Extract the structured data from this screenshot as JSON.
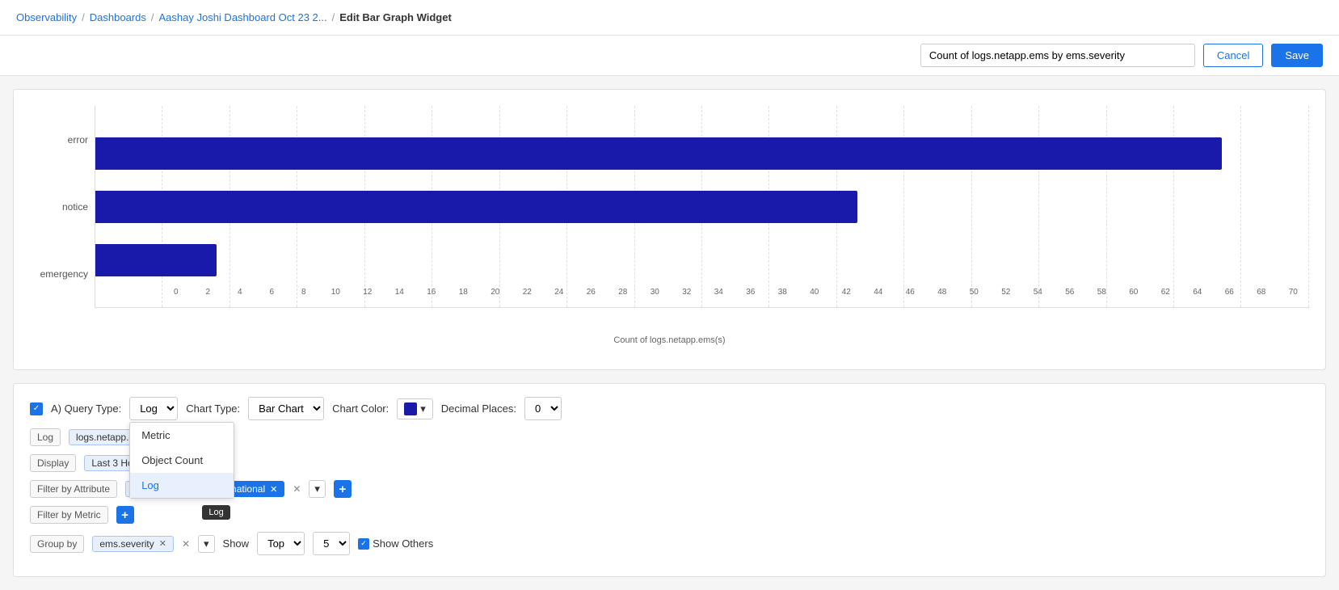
{
  "breadcrumb": {
    "items": [
      {
        "label": "Observability"
      },
      {
        "label": "Dashboards"
      },
      {
        "label": "Aashay Joshi Dashboard Oct 23 2..."
      }
    ],
    "current": "Edit Bar Graph Widget"
  },
  "header": {
    "widget_name": "Count of logs.netapp.ems by ems.severity",
    "cancel_label": "Cancel",
    "save_label": "Save"
  },
  "chart": {
    "bars": [
      {
        "label": "error",
        "value": 65,
        "max": 70
      },
      {
        "label": "notice",
        "value": 44,
        "max": 70
      },
      {
        "label": "emergency",
        "value": 7,
        "max": 70
      }
    ],
    "x_axis_labels": [
      "0",
      "2",
      "4",
      "6",
      "8",
      "10",
      "12",
      "14",
      "16",
      "18",
      "20",
      "22",
      "24",
      "26",
      "28",
      "30",
      "32",
      "34",
      "36",
      "38",
      "40",
      "42",
      "44",
      "46",
      "48",
      "50",
      "52",
      "54",
      "56",
      "58",
      "60",
      "62",
      "64",
      "66",
      "68",
      "70"
    ],
    "x_axis_title": "Count of logs.netapp.ems(s)"
  },
  "config": {
    "query_type_label": "A) Query Type:",
    "query_type_value": "Log",
    "query_type_options": [
      "Metric",
      "Object Count",
      "Log"
    ],
    "chart_type_label": "Chart Type:",
    "chart_type_value": "Bar Chart",
    "chart_color_label": "Chart Color:",
    "decimal_label": "Decimal Places:",
    "decimal_value": "0",
    "log_tag": "Log",
    "datasource_tag": "logs.netapp.ems",
    "display_label": "Display",
    "last_3_hours_label": "Last 3 Hours",
    "filter_attribute_label": "Filter by Attribute",
    "ems_severity_tag": "ems.severity",
    "informational_tag": "informational",
    "filter_metric_label": "Filter by Metric",
    "group_by_label": "Group by",
    "group_by_tag": "ems.severity",
    "show_label": "Show",
    "top_label": "Top",
    "top_value": "5",
    "show_others_label": "Show Others",
    "dropdown_items": [
      "Metric",
      "Object Count",
      "Log"
    ],
    "tooltip_text": "Log"
  }
}
